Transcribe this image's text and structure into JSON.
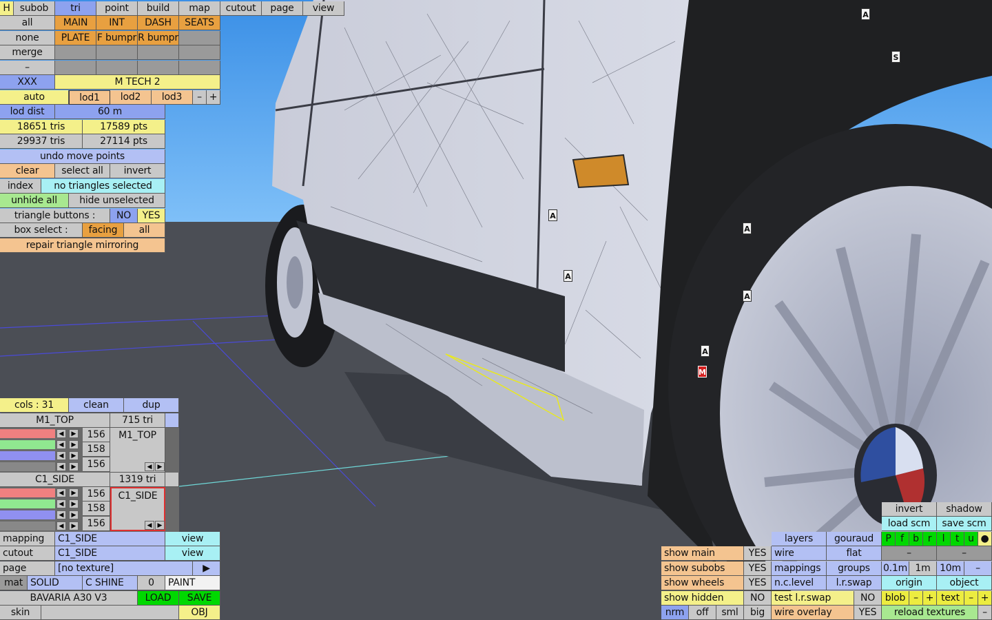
{
  "top_tabs": [
    "H",
    "subob",
    "tri",
    "point",
    "build",
    "map",
    "cutout",
    "page",
    "view"
  ],
  "left_panel": {
    "all": "all",
    "main": "MAIN",
    "int": "INT",
    "dash": "DASH",
    "seats": "SEATS",
    "none": "none",
    "plate": "PLATE",
    "f_bumpr": "F bumpr",
    "r_bumpr": "R bumpr",
    "merge": "merge",
    "dash_btn": "–",
    "xxx": "XXX",
    "car_name": "M TECH 2",
    "auto": "auto",
    "lod1": "lod1",
    "lod2": "lod2",
    "lod3": "lod3",
    "minus": "–",
    "plus": "+",
    "lod_dist_label": "lod dist",
    "lod_dist_value": "60 m",
    "tris1": "18651 tris",
    "pts1": "17589 pts",
    "tris2": "29937 tris",
    "pts2": "27114 pts",
    "undo": "undo move points",
    "clear": "clear",
    "select_all": "select all",
    "invert": "invert",
    "index": "index",
    "no_tri": "no triangles selected",
    "unhide_all": "unhide all",
    "hide_unselected": "hide unselected",
    "tri_buttons": "triangle buttons :",
    "no": "NO",
    "yes": "YES",
    "box_select": "box select :",
    "facing": "facing",
    "all2": "all",
    "repair": "repair triangle mirroring"
  },
  "color_panel": {
    "cols": "cols : 31",
    "clean": "clean",
    "dup": "dup",
    "mat1_name": "M1_TOP",
    "mat1_tri": "715 tri",
    "mat1_label": "M1_TOP",
    "mat1_vals": [
      "156",
      "158",
      "156"
    ],
    "mat2_name": "C1_SIDE",
    "mat2_tri": "1319 tri",
    "mat2_label": "C1_SIDE",
    "mat2_vals": [
      "156",
      "158",
      "156"
    ],
    "mapping": "mapping",
    "mapping_val": "C1_SIDE",
    "view1": "view",
    "cutout": "cutout",
    "cutout_val": "C1_SIDE",
    "view2": "view",
    "page": "page",
    "page_val": "[no texture]",
    "page_arrow": "▶",
    "mat": "mat",
    "solid": "SOLID",
    "cshine": "C SHINE",
    "zero": "0",
    "paint": "PAINT",
    "car": "BAVARIA A30 V3",
    "load": "LOAD",
    "save": "SAVE",
    "skin": "skin",
    "obj": "OBJ"
  },
  "bottom_right": {
    "invert": "invert",
    "shadow": "shadow",
    "load_scm": "load scm",
    "save_scm": "save scm",
    "layers": "layers",
    "gouraud": "gouraud",
    "pfbrltu": [
      "P",
      "f",
      "b",
      "r",
      "l",
      "t",
      "u"
    ],
    "dot": "●",
    "show_main": "show main",
    "show_main_v": "YES",
    "wire": "wire",
    "flat": "flat",
    "dash1": "–",
    "dash2": "–",
    "show_subobs": "show subobs",
    "show_subobs_v": "YES",
    "mappings": "mappings",
    "groups": "groups",
    "d01": "0.1m",
    "d1": "1m",
    "d10": "10m",
    "dminus": "–",
    "show_wheels": "show wheels",
    "show_wheels_v": "YES",
    "nclevel": "n.c.level",
    "lrswap": "l.r.swap",
    "origin": "origin",
    "object": "object",
    "show_hidden": "show hidden",
    "show_hidden_v": "NO",
    "test_lrswap": "test l.r.swap",
    "test_lrswap_v": "NO",
    "blob": "blob",
    "bm": "–",
    "bp": "+",
    "text": "text",
    "tm": "–",
    "tp": "+",
    "nrm": "nrm",
    "off": "off",
    "sml": "sml",
    "big": "big",
    "wire_overlay": "wire overlay",
    "wire_overlay_v": "YES",
    "reload": "reload textures",
    "rdash": "–"
  },
  "markers": [
    "A",
    "S",
    "A",
    "A",
    "A",
    "A",
    "A",
    "M"
  ]
}
